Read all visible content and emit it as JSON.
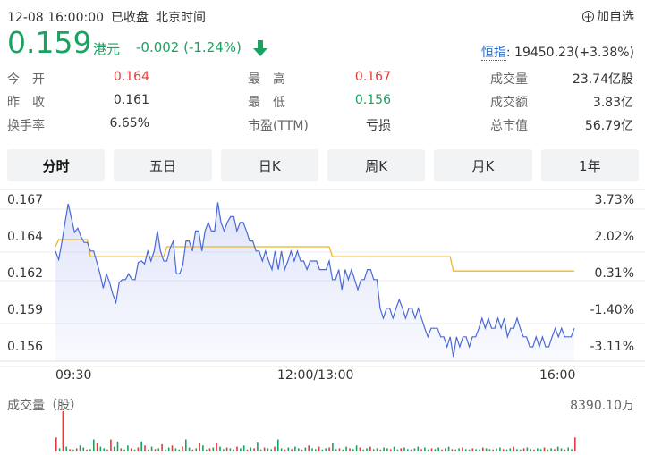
{
  "header": {
    "datetime": "12-08 16:00:00",
    "status": "已收盘",
    "timezone": "北京时间",
    "add_fav": "加自选"
  },
  "price": {
    "last": "0.159",
    "currency": "港元",
    "change": "-0.002 (-1.24%)"
  },
  "index": {
    "label": "恒指",
    "value": ": 19450.23(+3.38%)"
  },
  "quote": {
    "open_label": "今　开",
    "open": "0.164",
    "high_label": "最　高",
    "high": "0.167",
    "volume_label": "成交量",
    "volume": "23.74亿股",
    "prev_label": "昨　收",
    "prev": "0.161",
    "low_label": "最　低",
    "low": "0.156",
    "amount_label": "成交额",
    "amount": "3.83亿",
    "turnover_label": "换手率",
    "turnover": "6.65%",
    "pe_label": "市盈(TTM)",
    "pe": "亏损",
    "mcap_label": "总市值",
    "mcap": "56.79亿"
  },
  "tabs": [
    "分时",
    "五日",
    "日K",
    "周K",
    "月K",
    "1年"
  ],
  "colors": {
    "up": "#e23b3b",
    "down": "#1aa260",
    "line": "#4a68d8",
    "avg": "#f0b428"
  },
  "chart_data": {
    "type": "line",
    "y_ticks": [
      "0.167",
      "0.164",
      "0.162",
      "0.159",
      "0.156"
    ],
    "pct_ticks": [
      "3.73%",
      "2.02%",
      "0.31%",
      "-1.40%",
      "-3.11%"
    ],
    "x_ticks": [
      "09:30",
      "12:00/13:00",
      "16:00"
    ],
    "ylim": [
      0.1555,
      0.1675
    ],
    "prev_close": 0.161,
    "series": [
      {
        "values": [
          0.1632,
          0.1626,
          0.1638,
          0.1652,
          0.1665,
          0.1655,
          0.1645,
          0.1648,
          0.1642,
          0.1638,
          0.1638,
          0.1632,
          0.1632,
          0.1624,
          0.1616,
          0.1606,
          0.1616,
          0.161,
          0.1602,
          0.1596,
          0.161,
          0.1612,
          0.1612,
          0.1616,
          0.1612,
          0.1612,
          0.1624,
          0.1625,
          0.1623,
          0.1632,
          0.1625,
          0.1632,
          0.1646,
          0.1632,
          0.1625,
          0.1625,
          0.1634,
          0.1639,
          0.1616,
          0.1616,
          0.1622,
          0.1639,
          0.1639,
          0.1632,
          0.1646,
          0.1646,
          0.1632,
          0.1646,
          0.1652,
          0.1646,
          0.1646,
          0.1666,
          0.1652,
          0.1646,
          0.1652,
          0.1656,
          0.1656,
          0.1646,
          0.1652,
          0.1652,
          0.1646,
          0.1639,
          0.1639,
          0.1632,
          0.1632,
          0.1625,
          0.1632,
          0.1625,
          0.1619,
          0.1632,
          0.1619,
          0.1632,
          0.1619,
          0.1625,
          0.1632,
          0.1625,
          0.1632,
          0.1625,
          0.1625,
          0.1619,
          0.1625,
          0.1625,
          0.1625,
          0.1619,
          0.1619,
          0.1619,
          0.1625,
          0.1612,
          0.1612,
          0.1619,
          0.1605,
          0.1619,
          0.1612,
          0.1619,
          0.1612,
          0.1605,
          0.1612,
          0.1612,
          0.1619,
          0.1619,
          0.1612,
          0.1612,
          0.1592,
          0.1585,
          0.1592,
          0.1592,
          0.1585,
          0.1592,
          0.1598,
          0.1592,
          0.1585,
          0.1592,
          0.1592,
          0.1585,
          0.1592,
          0.1585,
          0.1578,
          0.1572,
          0.1578,
          0.1578,
          0.1578,
          0.1572,
          0.1572,
          0.1565,
          0.1572,
          0.1558,
          0.1572,
          0.1565,
          0.1572,
          0.1572,
          0.1565,
          0.1572,
          0.1572,
          0.1578,
          0.1585,
          0.1578,
          0.1585,
          0.1578,
          0.1578,
          0.1585,
          0.1578,
          0.1585,
          0.1572,
          0.1578,
          0.1578,
          0.1585,
          0.1578,
          0.1572,
          0.1572,
          0.1565,
          0.1565,
          0.1572,
          0.1565,
          0.1572,
          0.1565,
          0.1565,
          0.1572,
          0.1578,
          0.1572,
          0.1578,
          0.1572,
          0.1572,
          0.1572,
          0.1578
        ]
      },
      {
        "values": [
          0.1635,
          0.164,
          0.164,
          0.164,
          0.164,
          0.164,
          0.164,
          0.164,
          0.164,
          0.164,
          0.164,
          0.1628,
          0.1628,
          0.1628,
          0.1628,
          0.1628,
          0.1628,
          0.1628,
          0.1628,
          0.1628,
          0.1628,
          0.1628,
          0.1628,
          0.1628,
          0.1628,
          0.1628,
          0.1628,
          0.1628,
          0.1628,
          0.1628,
          0.1628,
          0.1628,
          0.1628,
          0.1628,
          0.1628,
          0.1635,
          0.1635,
          0.1635,
          0.1635,
          0.1635,
          0.1635,
          0.1635,
          0.1635,
          0.1635,
          0.1635,
          0.1635,
          0.1635,
          0.1635,
          0.1635,
          0.1635,
          0.1635,
          0.1635,
          0.1635,
          0.1635,
          0.1635,
          0.1635,
          0.1635,
          0.1635,
          0.1635,
          0.1635,
          0.1635,
          0.1635,
          0.1635,
          0.1635,
          0.1635,
          0.1635,
          0.1635,
          0.1635,
          0.1635,
          0.1635,
          0.1635,
          0.1635,
          0.1635,
          0.1635,
          0.1635,
          0.1635,
          0.1635,
          0.1635,
          0.1635,
          0.1635,
          0.1635,
          0.1635,
          0.1635,
          0.1635,
          0.1635,
          0.1635,
          0.1635,
          0.1628,
          0.1628,
          0.1628,
          0.1628,
          0.1628,
          0.1628,
          0.1628,
          0.1628,
          0.1628,
          0.1628,
          0.1628,
          0.1628,
          0.1628,
          0.1628,
          0.1628,
          0.1628,
          0.1628,
          0.1628,
          0.1628,
          0.1628,
          0.1628,
          0.1628,
          0.1628,
          0.1628,
          0.1628,
          0.1628,
          0.1628,
          0.1628,
          0.1628,
          0.1628,
          0.1628,
          0.1628,
          0.1628,
          0.1628,
          0.1628,
          0.1628,
          0.1628,
          0.1628,
          0.1618,
          0.1618,
          0.1618,
          0.1618,
          0.1618,
          0.1618,
          0.1618,
          0.1618,
          0.1618,
          0.1618,
          0.1618,
          0.1618,
          0.1618,
          0.1618,
          0.1618,
          0.1618,
          0.1618,
          0.1618,
          0.1618,
          0.1618,
          0.1618,
          0.1618,
          0.1618,
          0.1618,
          0.1618,
          0.1618,
          0.1618,
          0.1618,
          0.1618,
          0.1618,
          0.1618,
          0.1618,
          0.1618,
          0.1618,
          0.1618,
          0.1618,
          0.1618,
          0.1618,
          0.1618
        ]
      }
    ],
    "volume_label": "成交量（股）",
    "volume_max": "8390.10万",
    "volume": [
      {
        "v": 0.35,
        "c": "r"
      },
      {
        "v": 0.08,
        "c": "g"
      },
      {
        "v": 1.0,
        "c": "r"
      },
      {
        "v": 0.12,
        "c": "g"
      },
      {
        "v": 0.06,
        "c": "r"
      },
      {
        "v": 0.05,
        "c": "g"
      },
      {
        "v": 0.08,
        "c": "r"
      },
      {
        "v": 0.15,
        "c": "g"
      },
      {
        "v": 0.1,
        "c": "g"
      },
      {
        "v": 0.05,
        "c": "r"
      },
      {
        "v": 0.06,
        "c": "g"
      },
      {
        "v": 0.3,
        "c": "g"
      },
      {
        "v": 0.2,
        "c": "r"
      },
      {
        "v": 0.12,
        "c": "g"
      },
      {
        "v": 0.08,
        "c": "g"
      },
      {
        "v": 0.05,
        "c": "r"
      },
      {
        "v": 0.3,
        "c": "r"
      },
      {
        "v": 0.12,
        "c": "g"
      },
      {
        "v": 0.25,
        "c": "g"
      },
      {
        "v": 0.08,
        "c": "r"
      },
      {
        "v": 0.05,
        "c": "g"
      },
      {
        "v": 0.15,
        "c": "g"
      },
      {
        "v": 0.08,
        "c": "r"
      },
      {
        "v": 0.05,
        "c": "g"
      },
      {
        "v": 0.1,
        "c": "r"
      },
      {
        "v": 0.25,
        "c": "g"
      },
      {
        "v": 0.15,
        "c": "r"
      },
      {
        "v": 0.05,
        "c": "g"
      },
      {
        "v": 0.12,
        "c": "g"
      },
      {
        "v": 0.06,
        "c": "r"
      },
      {
        "v": 0.08,
        "c": "g"
      },
      {
        "v": 0.18,
        "c": "r"
      },
      {
        "v": 0.05,
        "c": "g"
      },
      {
        "v": 0.1,
        "c": "g"
      },
      {
        "v": 0.15,
        "c": "r"
      },
      {
        "v": 0.08,
        "c": "g"
      },
      {
        "v": 0.05,
        "c": "g"
      },
      {
        "v": 0.12,
        "c": "r"
      },
      {
        "v": 0.3,
        "c": "g"
      },
      {
        "v": 0.1,
        "c": "g"
      },
      {
        "v": 0.05,
        "c": "r"
      },
      {
        "v": 0.08,
        "c": "g"
      },
      {
        "v": 0.2,
        "c": "r"
      },
      {
        "v": 0.15,
        "c": "g"
      },
      {
        "v": 0.05,
        "c": "g"
      },
      {
        "v": 0.08,
        "c": "r"
      },
      {
        "v": 0.1,
        "c": "g"
      },
      {
        "v": 0.2,
        "c": "r"
      },
      {
        "v": 0.12,
        "c": "g"
      },
      {
        "v": 0.06,
        "c": "g"
      },
      {
        "v": 0.1,
        "c": "r"
      },
      {
        "v": 0.08,
        "c": "g"
      },
      {
        "v": 0.05,
        "c": "g"
      },
      {
        "v": 0.12,
        "c": "r"
      },
      {
        "v": 0.08,
        "c": "g"
      },
      {
        "v": 0.15,
        "c": "g"
      },
      {
        "v": 0.05,
        "c": "r"
      },
      {
        "v": 0.1,
        "c": "g"
      },
      {
        "v": 0.08,
        "c": "r"
      },
      {
        "v": 0.22,
        "c": "g"
      },
      {
        "v": 0.05,
        "c": "g"
      },
      {
        "v": 0.1,
        "c": "r"
      },
      {
        "v": 0.08,
        "c": "g"
      },
      {
        "v": 0.06,
        "c": "g"
      },
      {
        "v": 0.12,
        "c": "r"
      },
      {
        "v": 0.3,
        "c": "g"
      },
      {
        "v": 0.08,
        "c": "g"
      },
      {
        "v": 0.05,
        "c": "r"
      },
      {
        "v": 0.1,
        "c": "g"
      },
      {
        "v": 0.06,
        "c": "r"
      },
      {
        "v": 0.12,
        "c": "g"
      },
      {
        "v": 0.08,
        "c": "g"
      },
      {
        "v": 0.05,
        "c": "r"
      },
      {
        "v": 0.1,
        "c": "g"
      },
      {
        "v": 0.15,
        "c": "r"
      },
      {
        "v": 0.08,
        "c": "g"
      },
      {
        "v": 0.06,
        "c": "g"
      },
      {
        "v": 0.12,
        "c": "r"
      },
      {
        "v": 0.05,
        "c": "g"
      },
      {
        "v": 0.08,
        "c": "g"
      },
      {
        "v": 0.1,
        "c": "r"
      },
      {
        "v": 0.2,
        "c": "g"
      },
      {
        "v": 0.06,
        "c": "g"
      },
      {
        "v": 0.08,
        "c": "r"
      },
      {
        "v": 0.05,
        "c": "g"
      },
      {
        "v": 0.12,
        "c": "g"
      },
      {
        "v": 0.08,
        "c": "r"
      },
      {
        "v": 0.06,
        "c": "g"
      },
      {
        "v": 0.15,
        "c": "g"
      },
      {
        "v": 0.1,
        "c": "r"
      },
      {
        "v": 0.05,
        "c": "g"
      },
      {
        "v": 0.08,
        "c": "g"
      },
      {
        "v": 0.12,
        "c": "r"
      },
      {
        "v": 0.06,
        "c": "g"
      },
      {
        "v": 0.08,
        "c": "g"
      },
      {
        "v": 0.05,
        "c": "r"
      },
      {
        "v": 0.1,
        "c": "g"
      },
      {
        "v": 0.08,
        "c": "g"
      },
      {
        "v": 0.06,
        "c": "r"
      },
      {
        "v": 0.12,
        "c": "g"
      },
      {
        "v": 0.05,
        "c": "g"
      },
      {
        "v": 0.08,
        "c": "r"
      },
      {
        "v": 0.1,
        "c": "g"
      },
      {
        "v": 0.06,
        "c": "g"
      },
      {
        "v": 0.05,
        "c": "r"
      },
      {
        "v": 0.08,
        "c": "g"
      },
      {
        "v": 0.12,
        "c": "g"
      },
      {
        "v": 0.06,
        "c": "r"
      },
      {
        "v": 0.1,
        "c": "g"
      },
      {
        "v": 0.05,
        "c": "g"
      },
      {
        "v": 0.08,
        "c": "r"
      },
      {
        "v": 0.06,
        "c": "g"
      },
      {
        "v": 0.1,
        "c": "g"
      },
      {
        "v": 0.05,
        "c": "r"
      },
      {
        "v": 0.08,
        "c": "g"
      },
      {
        "v": 0.12,
        "c": "g"
      },
      {
        "v": 0.06,
        "c": "r"
      },
      {
        "v": 0.05,
        "c": "g"
      },
      {
        "v": 0.08,
        "c": "g"
      },
      {
        "v": 0.1,
        "c": "r"
      },
      {
        "v": 0.06,
        "c": "g"
      },
      {
        "v": 0.05,
        "c": "g"
      },
      {
        "v": 0.08,
        "c": "r"
      },
      {
        "v": 0.06,
        "c": "g"
      },
      {
        "v": 0.05,
        "c": "g"
      },
      {
        "v": 0.1,
        "c": "r"
      },
      {
        "v": 0.08,
        "c": "g"
      },
      {
        "v": 0.06,
        "c": "g"
      },
      {
        "v": 0.05,
        "c": "r"
      },
      {
        "v": 0.08,
        "c": "g"
      },
      {
        "v": 0.1,
        "c": "g"
      },
      {
        "v": 0.06,
        "c": "r"
      },
      {
        "v": 0.05,
        "c": "g"
      },
      {
        "v": 0.08,
        "c": "g"
      },
      {
        "v": 0.12,
        "c": "r"
      },
      {
        "v": 0.06,
        "c": "g"
      },
      {
        "v": 0.05,
        "c": "g"
      },
      {
        "v": 0.08,
        "c": "r"
      },
      {
        "v": 0.1,
        "c": "g"
      },
      {
        "v": 0.06,
        "c": "g"
      },
      {
        "v": 0.05,
        "c": "r"
      },
      {
        "v": 0.08,
        "c": "g"
      },
      {
        "v": 0.06,
        "c": "g"
      },
      {
        "v": 0.1,
        "c": "r"
      },
      {
        "v": 0.05,
        "c": "g"
      },
      {
        "v": 0.08,
        "c": "g"
      },
      {
        "v": 0.06,
        "c": "r"
      },
      {
        "v": 0.12,
        "c": "g"
      },
      {
        "v": 0.08,
        "c": "g"
      },
      {
        "v": 0.05,
        "c": "r"
      },
      {
        "v": 0.1,
        "c": "g"
      },
      {
        "v": 0.06,
        "c": "g"
      },
      {
        "v": 0.35,
        "c": "r"
      }
    ]
  }
}
